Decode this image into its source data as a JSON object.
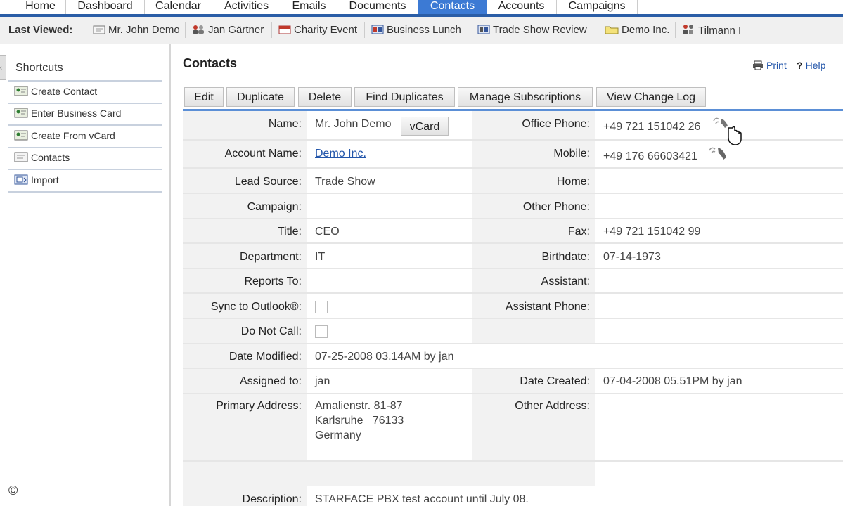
{
  "nav": {
    "tabs": [
      {
        "label": "Home"
      },
      {
        "label": "Dashboard"
      },
      {
        "label": "Calendar"
      },
      {
        "label": "Activities"
      },
      {
        "label": "Emails"
      },
      {
        "label": "Documents"
      },
      {
        "label": "Contacts",
        "active": true
      },
      {
        "label": "Accounts"
      },
      {
        "label": "Campaigns"
      }
    ],
    "active_color": "#3c7ad4",
    "bar_color": "#2a5da6"
  },
  "last_viewed": {
    "label": "Last Viewed:",
    "items": [
      {
        "label": "Mr. John Demo",
        "icon": "contact-card-icon"
      },
      {
        "label": "Jan Gärtner",
        "icon": "users-icon"
      },
      {
        "label": "Charity Event",
        "icon": "campaign-icon"
      },
      {
        "label": "Business Lunch",
        "icon": "meeting-icon"
      },
      {
        "label": "Trade Show Review",
        "icon": "meeting-icon"
      },
      {
        "label": "Demo Inc.",
        "icon": "account-folder-icon"
      },
      {
        "label": "Tilmann I",
        "icon": "lead-icon"
      }
    ]
  },
  "shortcuts": {
    "title": "Shortcuts",
    "items": [
      {
        "label": "Create Contact",
        "icon": "create-contact-icon"
      },
      {
        "label": "Enter Business Card",
        "icon": "business-card-icon"
      },
      {
        "label": "Create From vCard",
        "icon": "vcard-icon"
      },
      {
        "label": "Contacts",
        "icon": "contacts-icon"
      },
      {
        "label": "Import",
        "icon": "import-icon"
      }
    ]
  },
  "page": {
    "title": "Contacts",
    "print_label": "Print",
    "help_label": "Help"
  },
  "actions": [
    "Edit",
    "Duplicate",
    "Delete",
    "Find Duplicates",
    "Manage Subscriptions",
    "View Change Log"
  ],
  "detail": {
    "name_label": "Name:",
    "name_value": "Mr. John Demo",
    "vcard_label": "vCard",
    "office_phone_label": "Office Phone:",
    "office_phone_value": "+49 721 151042 26",
    "account_name_label": "Account Name:",
    "account_name_value": "Demo Inc.",
    "mobile_label": "Mobile:",
    "mobile_value": "+49 176 66603421",
    "lead_source_label": "Lead Source:",
    "lead_source_value": "Trade Show",
    "home_label": "Home:",
    "home_value": "",
    "campaign_label": "Campaign:",
    "campaign_value": "",
    "other_phone_label": "Other Phone:",
    "other_phone_value": "",
    "title_label": "Title:",
    "title_value": "CEO",
    "fax_label": "Fax:",
    "fax_value": "+49 721 151042 99",
    "department_label": "Department:",
    "department_value": "IT",
    "birthdate_label": "Birthdate:",
    "birthdate_value": "07-14-1973",
    "reports_to_label": "Reports To:",
    "reports_to_value": "",
    "assistant_label": "Assistant:",
    "assistant_value": "",
    "sync_label": "Sync to Outlook®:",
    "sync_checked": false,
    "assistant_phone_label": "Assistant Phone:",
    "assistant_phone_value": "",
    "do_not_call_label": "Do Not Call:",
    "do_not_call_checked": false,
    "date_modified_label": "Date Modified:",
    "date_modified_value": "07-25-2008 03.14AM by jan",
    "assigned_label": "Assigned to:",
    "assigned_value": "jan",
    "date_created_label": "Date Created:",
    "date_created_value": "07-04-2008 05.51PM by jan",
    "primary_address_label": "Primary Address:",
    "primary_address_line1": "Amalienstr. 81-87",
    "primary_address_line2": "Karlsruhe   76133",
    "primary_address_line3": "Germany",
    "other_address_label": "Other Address:",
    "description_label": "Description:",
    "description_value": "STARFACE PBX test account until July 08."
  },
  "footer": {
    "copyright_symbol": "©"
  }
}
